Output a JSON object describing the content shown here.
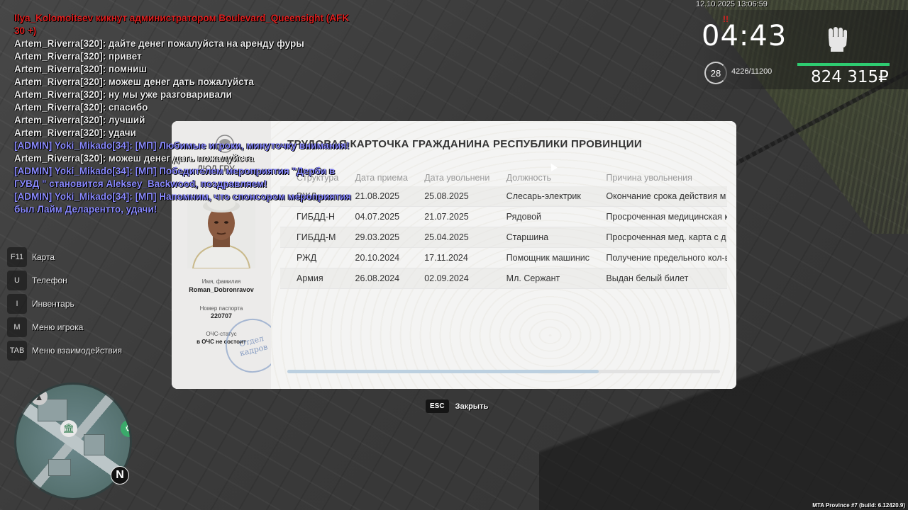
{
  "chat": [
    {
      "text": "Ilya_Kolomoitsev кикнут администратором Boulevard_Queensight (AFK 30 +)",
      "style": "red"
    },
    {
      "text": "Artem_Riverra[320]: дайте денег пожалуйста на аренду фуры",
      "style": "normal"
    },
    {
      "text": "Artem_Riverra[320]: привет",
      "style": "normal"
    },
    {
      "text": "Artem_Riverra[320]: помниш",
      "style": "normal"
    },
    {
      "text": "Artem_Riverra[320]: можеш денег дать пожалуйста",
      "style": "normal"
    },
    {
      "text": "Artem_Riverra[320]: ну мы уже разговаривали",
      "style": "normal"
    },
    {
      "text": "Artem_Riverra[320]: спасибо",
      "style": "normal"
    },
    {
      "text": "Artem_Riverra[320]: лучший",
      "style": "normal"
    },
    {
      "text": "Artem_Riverra[320]: удачи",
      "style": "normal"
    },
    {
      "text": "[ADMIN] Yoki_Mikado[34]: [МП] Любимые игроки, минуточку внимания!",
      "style": "admin"
    },
    {
      "text": "Artem_Riverra[320]: можеш денег дать пожалуйста",
      "style": "normal"
    },
    {
      "text": "[ADMIN] Yoki_Mikado[34]: [МП] Победителем мероприятия \"Дерби в ГУВД \" становится Aleksey_Backwood, поздравляем!",
      "style": "admin"
    },
    {
      "text": "[ADMIN] Yoki_Mikado[34]: [МП] Напомним, что спонсором мероприятия  был Лайм Деларентто, удачи!",
      "style": "admin"
    }
  ],
  "hud": {
    "datetime": "12.10.2025 13:06:59",
    "flag": "!!",
    "time": "04:43",
    "level": "28",
    "xp": "4226/11200",
    "money": "824 315₽",
    "health_fraction": 1.0
  },
  "hints": [
    {
      "key": "F11",
      "label": "Карта"
    },
    {
      "key": "U",
      "label": "Телефон"
    },
    {
      "key": "I",
      "label": "Инвентарь"
    },
    {
      "key": "M",
      "label": "Меню игрока"
    },
    {
      "key": "TAB",
      "label": "Меню взаимодействия"
    }
  ],
  "card": {
    "ministry": "ЛЮД ГРУ",
    "title": "ТРУДОВАЯ КАРТОЧКА ГРАЖДАНИНА РЕСПУБЛИКИ ПРОВИНЦИИ",
    "name_label": "Имя, фамилия",
    "name_value": "Roman_Dobronravov",
    "passport_label": "Номер паспорта",
    "passport_value": "220707",
    "och_label": "ОЧС-статус",
    "och_value": "в ОЧС не состоит",
    "stamp_line1": "Отдел",
    "stamp_line2": "кадров",
    "columns": [
      "Структура",
      "Дата приема",
      "Дата увольнени",
      "Должность",
      "Причина увольнения"
    ],
    "rows": [
      [
        "РЖД",
        "21.08.2025",
        "25.08.2025",
        "Слесарь-электрик",
        "Окончание срока действия м"
      ],
      [
        "ГИБДД-Н",
        "04.07.2025",
        "21.07.2025",
        "Рядовой",
        "Просроченная медицинская к"
      ],
      [
        "ГИБДД-М",
        "29.03.2025",
        "25.04.2025",
        "Старшина",
        "Просроченная мед. карта с д"
      ],
      [
        "РЖД",
        "20.10.2024",
        "17.11.2024",
        "Помощник машинис",
        "Получение предельного кол-в"
      ],
      [
        "Армия",
        "26.08.2024",
        "02.09.2024",
        "Мл. Сержант",
        "Выдан белый билет"
      ]
    ],
    "scroll_fraction": 0.72
  },
  "close": {
    "key": "ESC",
    "label": "Закрыть"
  },
  "minimap": {
    "north": "N"
  },
  "build": "MTA Province #7 (build: 6.12420.9)"
}
